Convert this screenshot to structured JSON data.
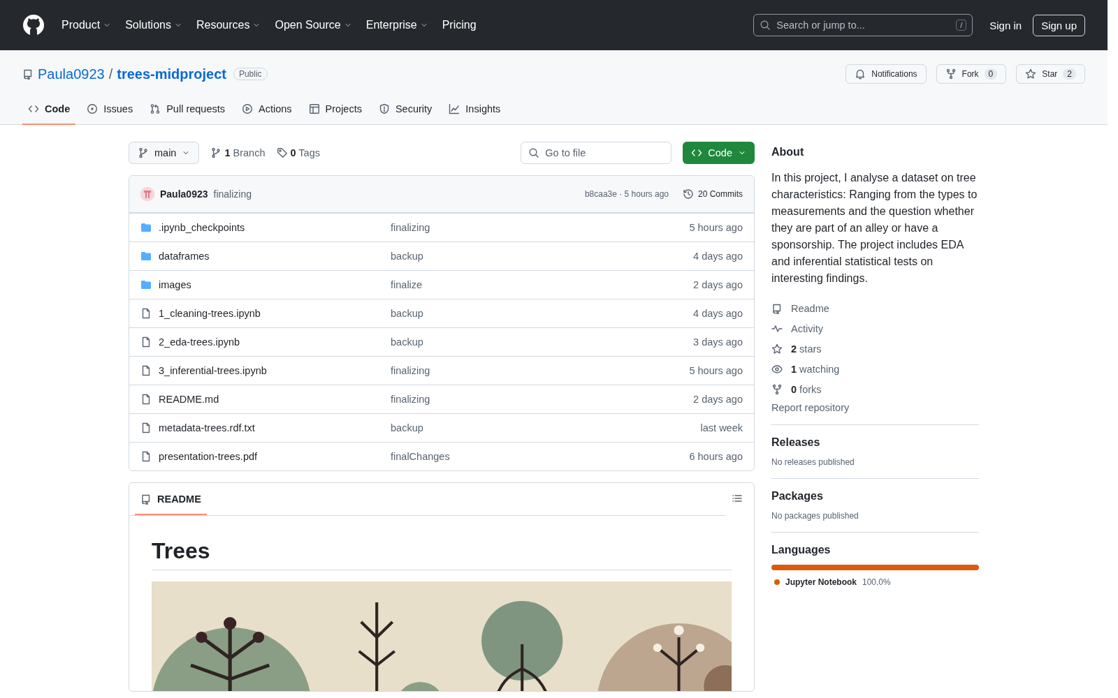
{
  "header": {
    "nav": [
      {
        "label": "Product",
        "dropdown": true
      },
      {
        "label": "Solutions",
        "dropdown": true
      },
      {
        "label": "Resources",
        "dropdown": true
      },
      {
        "label": "Open Source",
        "dropdown": true
      },
      {
        "label": "Enterprise",
        "dropdown": true
      },
      {
        "label": "Pricing",
        "dropdown": false
      }
    ],
    "search": {
      "placeholder": "Search or jump to...",
      "shortcut": "/"
    },
    "sign_in": "Sign in",
    "sign_up": "Sign up"
  },
  "repo": {
    "owner": "Paula0923",
    "separator": "/",
    "name": "trees-midproject",
    "visibility": "Public",
    "actions": [
      {
        "label": "Notifications"
      },
      {
        "label": "Fork",
        "count": "0"
      },
      {
        "label": "Star",
        "count": "2"
      }
    ],
    "tabs": [
      {
        "label": "Code",
        "selected": true
      },
      {
        "label": "Issues",
        "selected": false
      },
      {
        "label": "Pull requests",
        "selected": false
      },
      {
        "label": "Actions",
        "selected": false
      },
      {
        "label": "Projects",
        "selected": false
      },
      {
        "label": "Security",
        "selected": false
      },
      {
        "label": "Insights",
        "selected": false
      }
    ]
  },
  "toolbar": {
    "branch": "main",
    "branches": "**1** Branch",
    "tags": "**0** Tags",
    "go_to_file": {
      "placeholder": "Go to file"
    },
    "code_button": "Code"
  },
  "commit": {
    "author": "Paula0923",
    "message": "finalizing",
    "hash": "b8caa3e · 5 hours ago",
    "commits": "20 Commits"
  },
  "files": [
    {
      "kind": "folder",
      "name": ".ipynb_checkpoints",
      "message": "finalizing",
      "time": "5 hours ago"
    },
    {
      "kind": "folder",
      "name": "dataframes",
      "message": "backup",
      "time": "4 days ago"
    },
    {
      "kind": "folder",
      "name": "images",
      "message": "finalize",
      "time": "2 days ago"
    },
    {
      "kind": "file",
      "name": "1_cleaning-trees.ipynb",
      "message": "backup",
      "time": "4 days ago"
    },
    {
      "kind": "file",
      "name": "2_eda-trees.ipynb",
      "message": "backup",
      "time": "3 days ago"
    },
    {
      "kind": "file",
      "name": "3_inferential-trees.ipynb",
      "message": "finalizing",
      "time": "5 hours ago"
    },
    {
      "kind": "file",
      "name": "README.md",
      "message": "finalizing",
      "time": "2 days ago"
    },
    {
      "kind": "file",
      "name": "metadata-trees.rdf.txt",
      "message": "backup",
      "time": "last week"
    },
    {
      "kind": "file",
      "name": "presentation-trees.pdf",
      "message": "finalChanges",
      "time": "6 hours ago"
    }
  ],
  "readme": {
    "tab": "README",
    "heading": "Trees"
  },
  "about": {
    "title": "About",
    "description": "In this project, I analyse a dataset on tree characteristics: Ranging from the types to measurements and the question whether they are part of an alley or have a sponsorship. The project includes EDA and inferential statistical tests on interesting findings.",
    "links": [
      "Readme",
      "Activity",
      "**2** stars",
      "**1** watching",
      "**0** forks"
    ],
    "report": "Report repository",
    "sections": [
      {
        "title": "Releases",
        "note": "No releases published"
      },
      {
        "title": "Packages",
        "note": "No packages published"
      }
    ],
    "languages": {
      "title": "Languages",
      "items": [
        {
          "name": "Jupyter Notebook",
          "percent": "100.0%",
          "level": 1.0,
          "color": "#da5b0b"
        }
      ]
    }
  }
}
